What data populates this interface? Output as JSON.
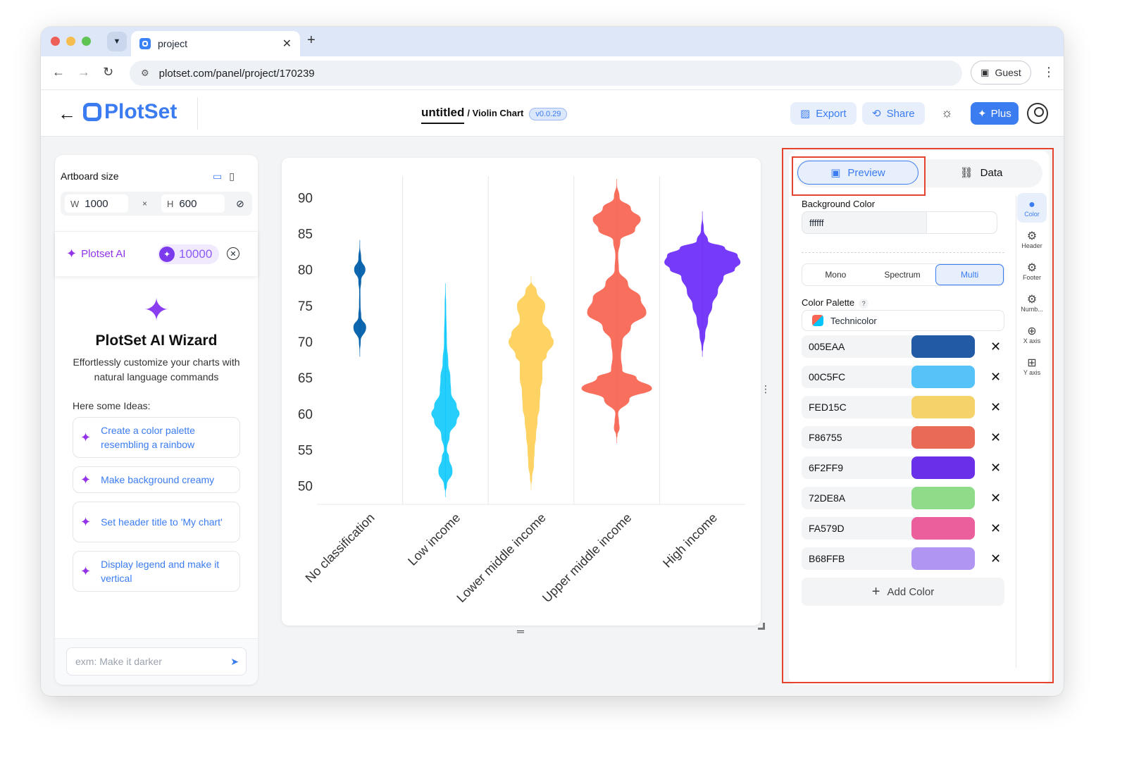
{
  "browser": {
    "tab_title": "project",
    "url": "plotset.com/panel/project/170239",
    "guest_label": "Guest"
  },
  "header": {
    "logo_text": "PlotSet",
    "doc_name": "untitled",
    "chart_type": "/ Violin Chart",
    "version": "v0.0.29",
    "export_label": "Export",
    "share_label": "Share",
    "plus_label": "Plus"
  },
  "left": {
    "artboard_label": "Artboard size",
    "w_key": "W",
    "w_value": "1000",
    "times": "×",
    "h_key": "H",
    "h_value": "600",
    "ai_name": "Plotset AI",
    "credits": "10000",
    "wizard_title": "PlotSet AI Wizard",
    "wizard_desc": "Effortlessly customize your charts with natural language commands",
    "ideas_label": "Here some Ideas:",
    "ideas": [
      "Create a color palette resembling a rainbow",
      "Make background creamy",
      "Set header title to 'My chart'",
      "Display legend and make it vertical"
    ],
    "prompt_placeholder": "exm: Make it darker"
  },
  "chart_data": {
    "type": "violin",
    "categories": [
      "No classification",
      "Low income",
      "Lower middle income",
      "Upper middle income",
      "High income"
    ],
    "category_labels": [
      "No classification",
      "Low income",
      "Lower middle income",
      "Upper middle income",
      "High income"
    ],
    "colors": [
      "#005EAA",
      "#00C5FC",
      "#FED15C",
      "#F86755",
      "#6F2FF9"
    ],
    "ylim": [
      48,
      92
    ],
    "yticks": [
      "50",
      "55",
      "60",
      "65",
      "70",
      "75",
      "80",
      "85",
      "90"
    ],
    "violins": [
      {
        "range": [
          68.5,
          83.5
        ],
        "profile": [
          [
            68.5,
            0.1
          ],
          [
            70,
            1.2
          ],
          [
            72,
            9
          ],
          [
            73.5,
            2
          ],
          [
            75,
            1
          ],
          [
            77,
            0.8
          ],
          [
            78.5,
            2
          ],
          [
            80,
            8
          ],
          [
            81.5,
            2
          ],
          [
            83.5,
            0.1
          ]
        ]
      },
      {
        "range": [
          49,
          77.5
        ],
        "profile": [
          [
            49,
            0.1
          ],
          [
            50,
            2
          ],
          [
            52,
            10
          ],
          [
            54,
            5
          ],
          [
            55,
            2
          ],
          [
            57,
            6
          ],
          [
            59,
            16
          ],
          [
            60,
            20
          ],
          [
            61,
            16
          ],
          [
            63,
            8
          ],
          [
            65,
            7
          ],
          [
            67,
            4
          ],
          [
            70,
            2
          ],
          [
            75,
            1
          ],
          [
            77.5,
            0.1
          ]
        ]
      },
      {
        "range": [
          50,
          78.5
        ],
        "profile": [
          [
            50,
            0.1
          ],
          [
            51,
            1.5
          ],
          [
            53,
            4
          ],
          [
            55,
            5
          ],
          [
            57,
            7
          ],
          [
            59,
            9
          ],
          [
            61,
            12
          ],
          [
            63,
            13
          ],
          [
            65,
            16
          ],
          [
            67,
            16
          ],
          [
            68,
            22
          ],
          [
            70,
            32
          ],
          [
            71,
            28
          ],
          [
            73,
            16
          ],
          [
            75,
            20
          ],
          [
            77,
            8
          ],
          [
            78.5,
            0.1
          ]
        ]
      },
      {
        "range": [
          56.5,
          92
        ],
        "profile": [
          [
            56.5,
            0.1
          ],
          [
            57,
            1
          ],
          [
            58,
            4
          ],
          [
            59,
            3
          ],
          [
            60,
            2
          ],
          [
            62,
            18
          ],
          [
            63.5,
            50
          ],
          [
            65,
            28
          ],
          [
            66,
            8
          ],
          [
            68,
            6
          ],
          [
            70,
            8
          ],
          [
            72,
            20
          ],
          [
            74,
            42
          ],
          [
            76,
            34
          ],
          [
            78,
            16
          ],
          [
            80,
            3
          ],
          [
            82,
            2
          ],
          [
            84,
            5
          ],
          [
            85.5,
            26
          ],
          [
            87,
            34
          ],
          [
            88.5,
            20
          ],
          [
            90,
            4
          ],
          [
            92,
            0.1
          ]
        ]
      },
      {
        "range": [
          68.5,
          87.5
        ],
        "profile": [
          [
            68.5,
            0.1
          ],
          [
            69,
            1
          ],
          [
            71,
            4
          ],
          [
            73,
            8
          ],
          [
            75,
            14
          ],
          [
            77,
            22
          ],
          [
            79,
            30
          ],
          [
            80,
            46
          ],
          [
            81,
            54
          ],
          [
            82,
            50
          ],
          [
            83,
            32
          ],
          [
            84,
            8
          ],
          [
            85.5,
            2
          ],
          [
            87.5,
            0.1
          ]
        ]
      }
    ]
  },
  "right": {
    "tab_preview": "Preview",
    "tab_data": "Data",
    "bg_label": "Background Color",
    "bg_value": "ffffff",
    "modes": [
      "Mono",
      "Spectrum",
      "Multi"
    ],
    "palette_label": "Color Palette",
    "palette_help": "?",
    "palette_name": "Technicolor",
    "colors": [
      "005EAA",
      "00C5FC",
      "FED15C",
      "F86755",
      "6F2FF9",
      "72DE8A",
      "FA579D",
      "B68FFB"
    ],
    "color_hex": [
      "#225aa5",
      "#55c2f8",
      "#f6d36a",
      "#e96a55",
      "#6a2fe8",
      "#8edb8a",
      "#ea5f9c",
      "#b195f3"
    ],
    "add_color_label": "Add Color",
    "side_tabs": [
      "Color",
      "Header",
      "Footer",
      "Numb...",
      "X axis",
      "Y axis"
    ]
  }
}
